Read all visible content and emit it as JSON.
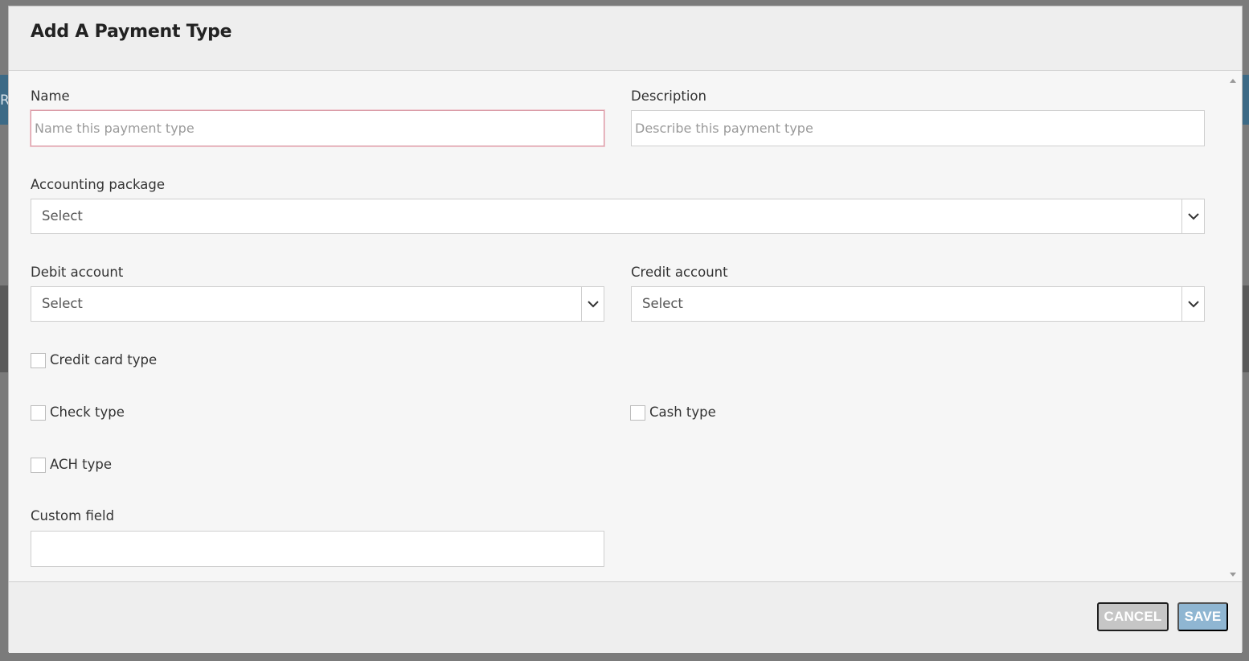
{
  "background": {
    "edge_text": "Re"
  },
  "modal": {
    "title": "Add A Payment Type",
    "fields": {
      "name": {
        "label": "Name",
        "placeholder": "Name this payment type",
        "value": ""
      },
      "description": {
        "label": "Description",
        "placeholder": "Describe this payment type",
        "value": ""
      },
      "accounting_package": {
        "label": "Accounting package",
        "selected": "Select"
      },
      "debit_account": {
        "label": "Debit account",
        "selected": "Select"
      },
      "credit_account": {
        "label": "Credit account",
        "selected": "Select"
      },
      "custom_field": {
        "label": "Custom field",
        "value": ""
      }
    },
    "checkboxes": {
      "credit_card_type": {
        "label": "Credit card type",
        "checked": false
      },
      "check_type": {
        "label": "Check type",
        "checked": false
      },
      "cash_type": {
        "label": "Cash type",
        "checked": false
      },
      "ach_type": {
        "label": "ACH type",
        "checked": false
      }
    },
    "footer": {
      "cancel_label": "CANCEL",
      "save_label": "SAVE"
    }
  },
  "colors": {
    "accent_save": "#8fb6d2",
    "cancel_bg": "#c6c6c6",
    "focus_border": "#d99aa5"
  },
  "icons": {
    "select_arrow": "chevron-down-icon",
    "scroll_up": "scroll-up-arrow-icon",
    "scroll_down": "scroll-down-arrow-icon"
  }
}
